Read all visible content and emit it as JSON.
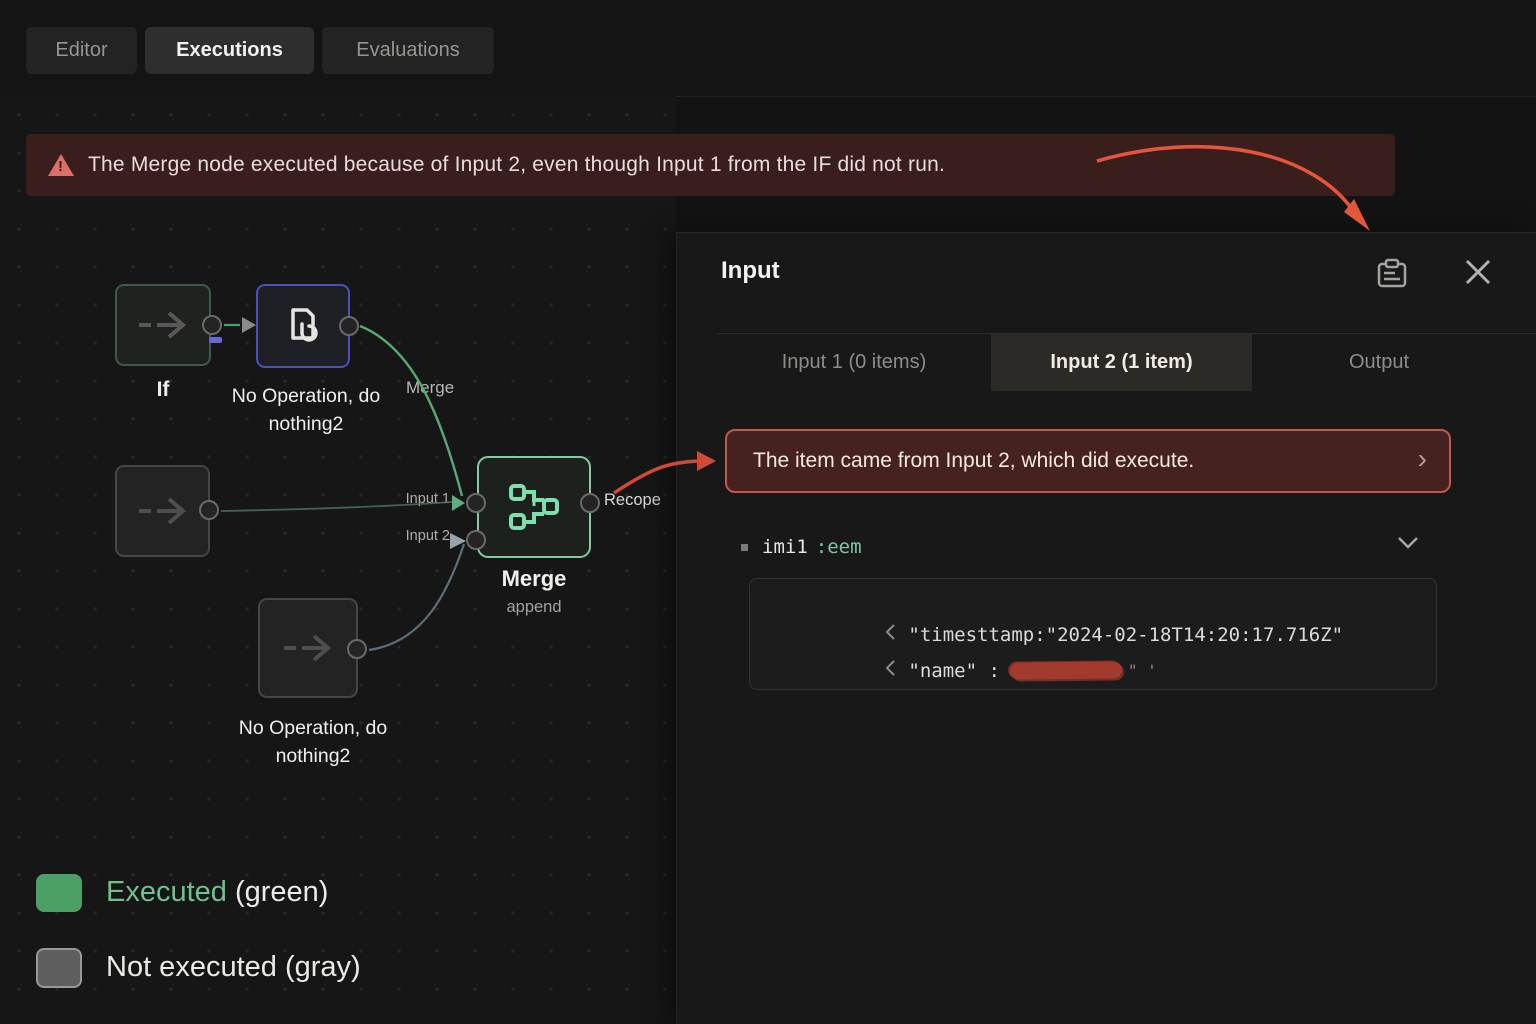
{
  "topbar": {
    "tabs": [
      {
        "label": "Editor"
      },
      {
        "label": "Executions"
      },
      {
        "label": "Evaluations"
      }
    ],
    "active_tab": "Executions"
  },
  "banner": {
    "text": "The Merge node executed because of Input 2, even though Input 1 from the IF did not run.",
    "background": "#3a1e1c",
    "icon_color": "#dd7066"
  },
  "canvas": {
    "nodes": {
      "if_node": {
        "label": "If",
        "status": "executed"
      },
      "noop_top": {
        "label": "No Operation, do nothing2",
        "status": "executed"
      },
      "gray_node": {
        "label": "",
        "status": "not-executed"
      },
      "merge": {
        "label": "Merge",
        "subtitle": "append",
        "input1_label": "Input 1",
        "input2_label": "Input 2",
        "output_label": "Recope",
        "status": "executed"
      },
      "noop_bottom": {
        "label": "No Operation, do nothing2",
        "status": "not-executed"
      }
    },
    "edge_label": "Merge",
    "legend": [
      {
        "label": "Executed",
        "suffix": " (green)",
        "color": "#4ca065"
      },
      {
        "label": "Not executed (gray)",
        "suffix": "",
        "color": "#5e5e5e"
      }
    ],
    "colors": {
      "executed_border": "#84cc9e",
      "not_executed_border": "#464646",
      "edge_green": "#57a874",
      "arrow_red": "#d9503c"
    }
  },
  "panel": {
    "title": "Input",
    "tabs": [
      {
        "label": "Input 1 (0 items)"
      },
      {
        "label": "Input 2 (1 item)"
      },
      {
        "label": "Output"
      }
    ],
    "active_tab": "Input 2 (1 item)",
    "callout": {
      "text": "The item came from Input 2, which did execute.",
      "chevron": "›"
    },
    "json_row": {
      "key": "imi1",
      "value": ":eem"
    },
    "code": {
      "line1": "\"timesttamp:\"2024-02-18T14:20:17.716Z\"",
      "line2_key": "\"name\" :",
      "line2_tail": "\" '"
    }
  }
}
